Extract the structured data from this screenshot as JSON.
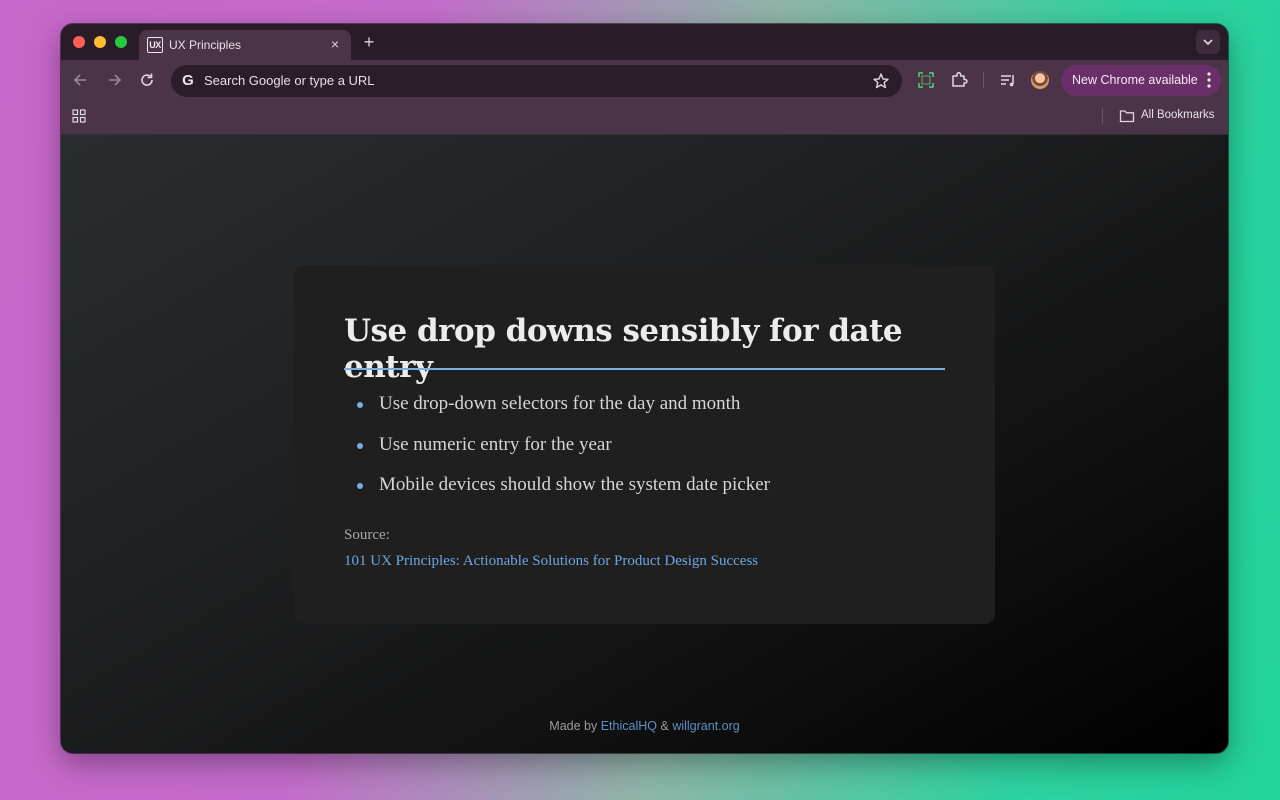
{
  "browser": {
    "tab": {
      "favicon": "UX",
      "title": "UX Principles"
    },
    "omnibox": {
      "placeholder": "Search Google or type a URL"
    },
    "update_button": "New Chrome available",
    "bookmarks": {
      "all_bookmarks": "All Bookmarks"
    }
  },
  "card": {
    "title": "Use drop downs sensibly for date entry",
    "points": [
      "Use drop-down selectors for the day and month",
      "Use numeric entry for the year",
      "Mobile devices should show the system date picker"
    ],
    "source_label": "Source:",
    "source_link": "101 UX Principles: Actionable Solutions for Product Design Success"
  },
  "footer": {
    "prefix": "Made by",
    "link1": "EthicalHQ",
    "amp": "&",
    "link2": "willgrant.org"
  },
  "colors": {
    "accent": "#7aaee6",
    "link": "#6ea6e0",
    "chrome_frame": "#4b3448"
  }
}
